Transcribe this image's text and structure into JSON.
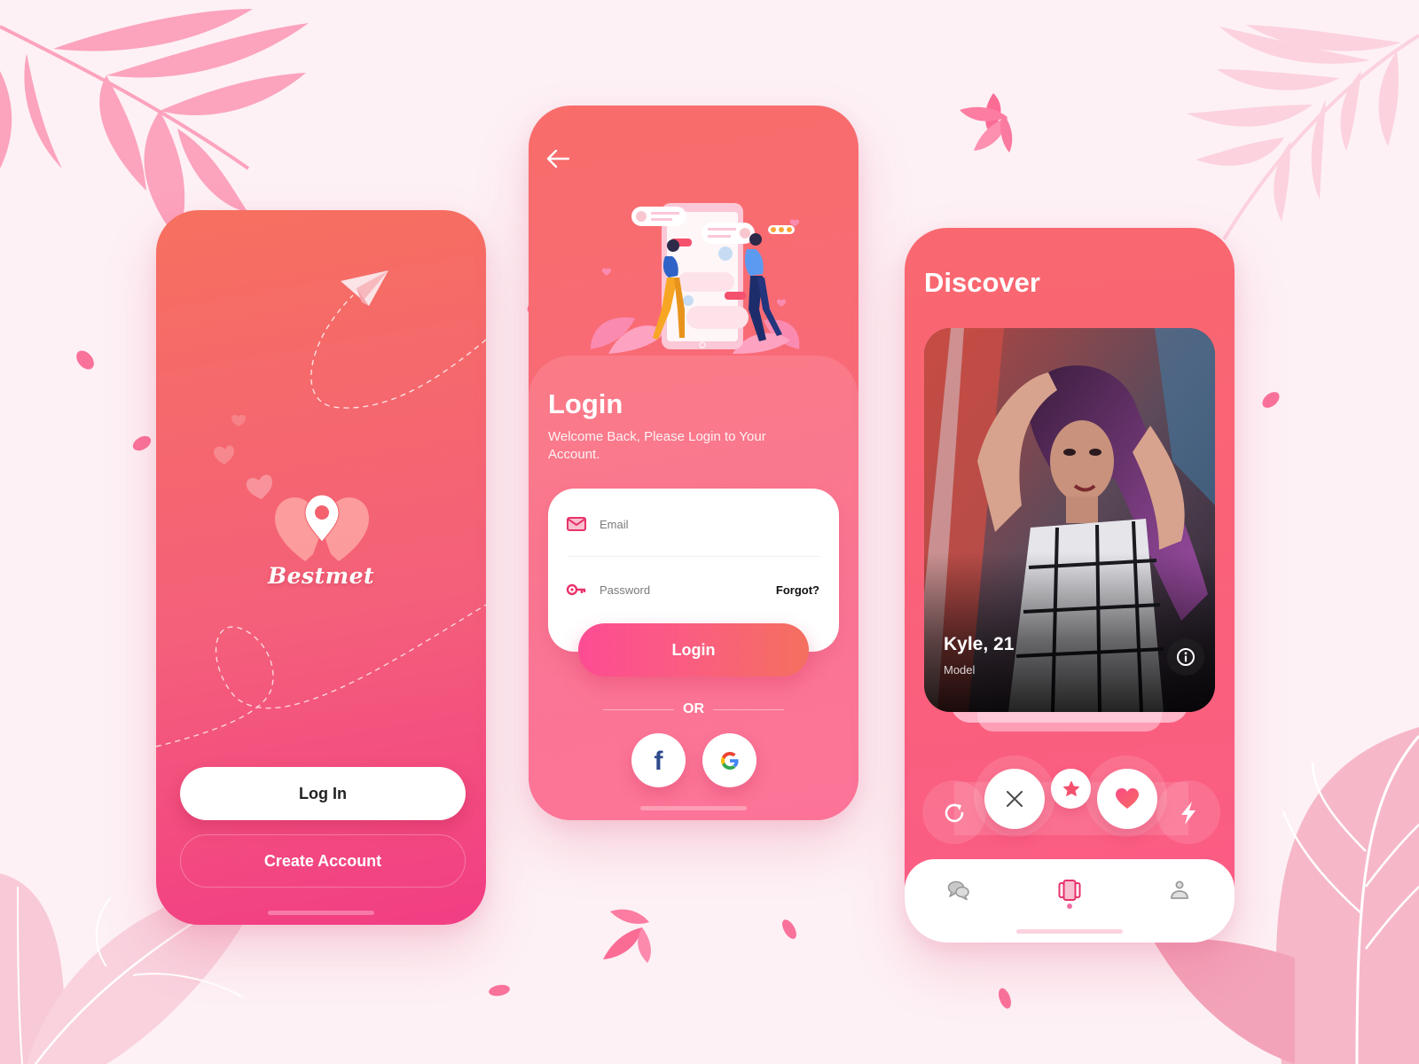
{
  "theme": {
    "accent": "#f9617a",
    "accent_pink": "#f23d84",
    "accent_coral": "#f6705f",
    "background": "#fdf1f5",
    "icon_pink": "#e8336b",
    "nav_inactive": "#a9a9a9"
  },
  "welcome_screen": {
    "brand_name": "Bestmet",
    "logo_icon": "heart-location-pin-icon",
    "decor_icons": [
      "paper-plane-icon",
      "heart-icon",
      "heart-icon",
      "heart-icon"
    ],
    "login_button": "Log In",
    "create_account_button": "Create Account"
  },
  "login_screen": {
    "back_icon": "arrow-left-icon",
    "illustration": "couple-chatting-illustration",
    "title": "Login",
    "subtitle": "Welcome Back, Please Login to Your Account.",
    "email": {
      "icon": "envelope-icon",
      "placeholder": "Email",
      "value": ""
    },
    "password": {
      "icon": "key-icon",
      "placeholder": "Password",
      "value": ""
    },
    "forgot_link": "Forgot?",
    "login_button": "Login",
    "divider_text": "OR",
    "social": [
      {
        "name": "facebook",
        "icon": "facebook-icon",
        "glyph": "f"
      },
      {
        "name": "google",
        "icon": "google-icon"
      }
    ]
  },
  "discover_screen": {
    "title": "Discover",
    "profile": {
      "name_age": "Kyle, 21",
      "occupation": "Model",
      "info_icon": "info-icon"
    },
    "actions": [
      {
        "name": "rewind",
        "icon": "rewind-icon"
      },
      {
        "name": "nope",
        "icon": "close-icon"
      },
      {
        "name": "super-like",
        "icon": "star-icon"
      },
      {
        "name": "like",
        "icon": "heart-icon"
      },
      {
        "name": "boost",
        "icon": "lightning-icon"
      }
    ],
    "bottom_nav": [
      {
        "name": "chats",
        "icon": "chat-bubbles-icon",
        "active": false
      },
      {
        "name": "discover",
        "icon": "cards-icon",
        "active": true
      },
      {
        "name": "profile",
        "icon": "user-icon",
        "active": false
      }
    ]
  }
}
